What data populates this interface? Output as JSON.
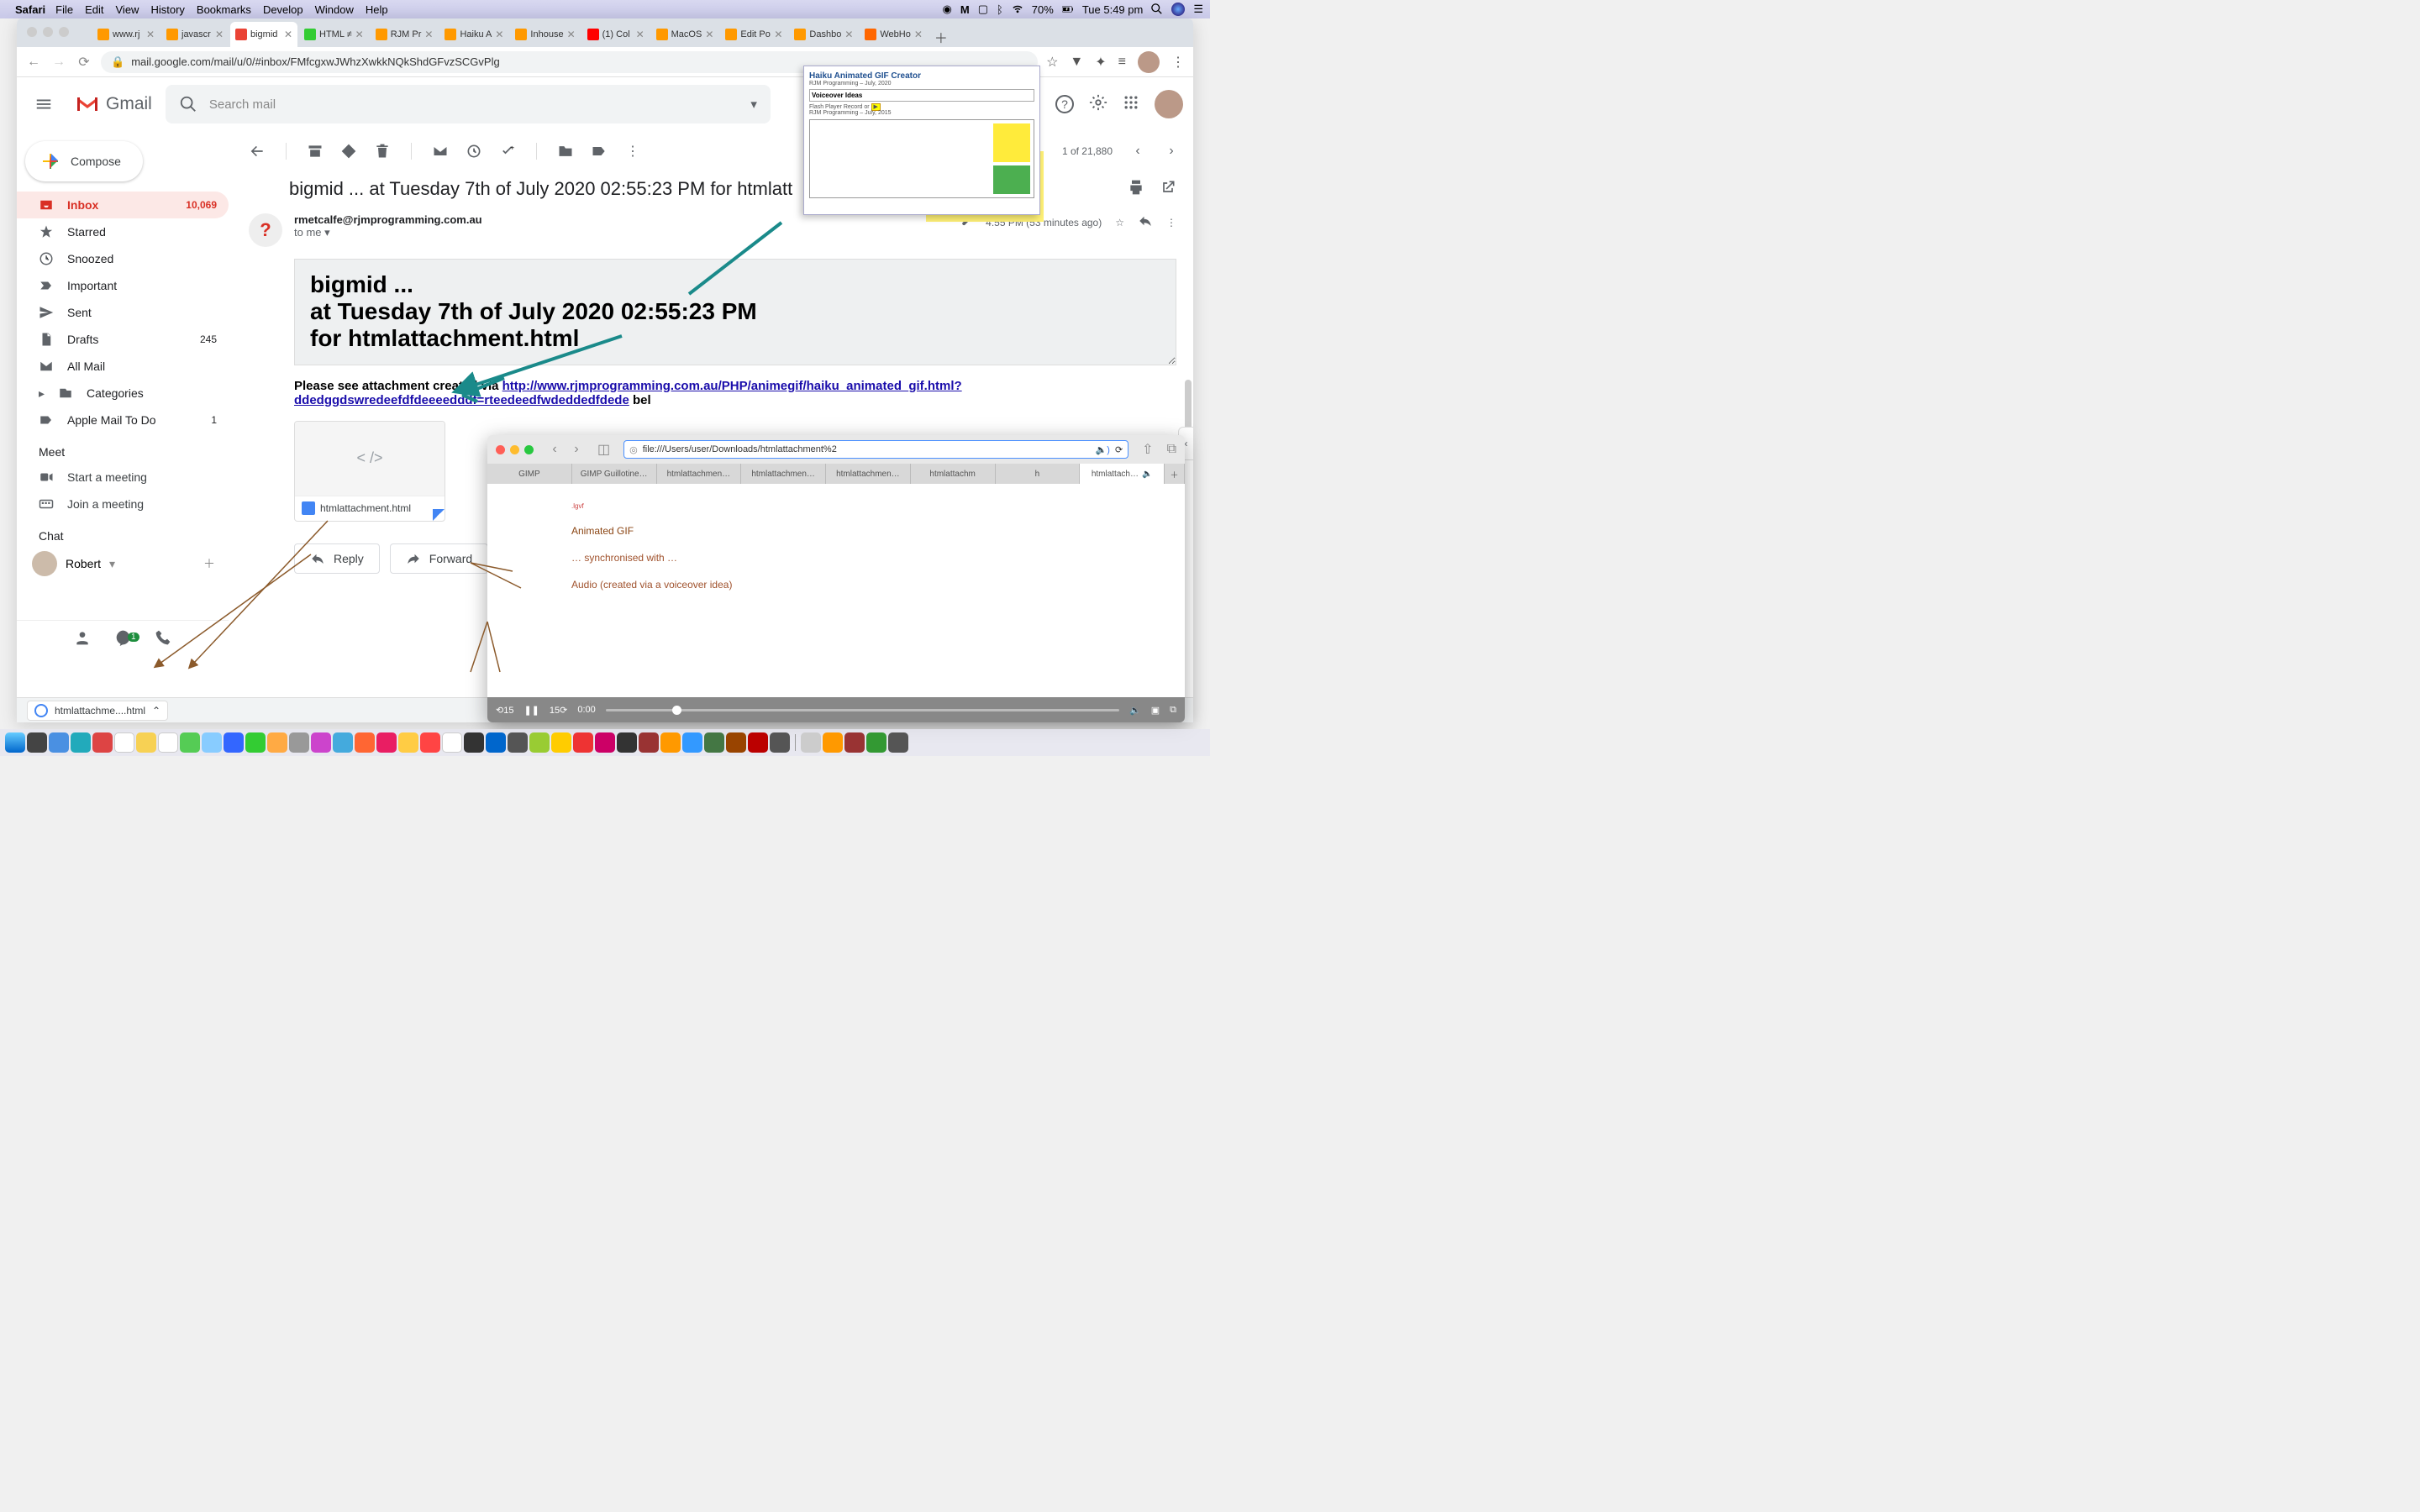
{
  "menubar": {
    "app": "Safari",
    "items": [
      "File",
      "Edit",
      "View",
      "History",
      "Bookmarks",
      "Develop",
      "Window",
      "Help"
    ],
    "battery_pct": "70%",
    "clock": "Tue 5:49 pm"
  },
  "tabs": [
    {
      "label": "www.rj"
    },
    {
      "label": "javascr"
    },
    {
      "label": "bigmid",
      "active": true
    },
    {
      "label": "HTML ≠"
    },
    {
      "label": "RJM Pr"
    },
    {
      "label": "Haiku A"
    },
    {
      "label": "Inhouse"
    },
    {
      "label": "(1) Col"
    },
    {
      "label": "MacOS"
    },
    {
      "label": "Edit Po"
    },
    {
      "label": "Dashbo"
    },
    {
      "label": "WebHo"
    }
  ],
  "omnibox": {
    "url": "mail.google.com/mail/u/0/#inbox/FMfcgxwJWhzXwkkNQkShdGFvzSCGvPlg"
  },
  "gmail": {
    "brand": "Gmail",
    "search_placeholder": "Search mail",
    "compose": "Compose",
    "sidebar": [
      {
        "label": "Inbox",
        "count": "10,069",
        "active": true,
        "icon": "inbox"
      },
      {
        "label": "Starred",
        "icon": "star"
      },
      {
        "label": "Snoozed",
        "icon": "clock"
      },
      {
        "label": "Important",
        "icon": "important"
      },
      {
        "label": "Sent",
        "icon": "send"
      },
      {
        "label": "Drafts",
        "count": "245",
        "icon": "file"
      },
      {
        "label": "All Mail",
        "icon": "mail"
      },
      {
        "label": "Categories",
        "icon": "tag",
        "expandable": true
      },
      {
        "label": "Apple Mail To Do",
        "count": "1",
        "icon": "tag"
      }
    ],
    "meet_header": "Meet",
    "meet": [
      {
        "label": "Start a meeting",
        "icon": "video"
      },
      {
        "label": "Join a meeting",
        "icon": "keyboard"
      }
    ],
    "chat_header": "Chat",
    "chat_user": "Robert",
    "page_counter": "1 of 21,880"
  },
  "email": {
    "subject": "bigmid ... at Tuesday 7th of July 2020 02:55:23 PM for htmlatt",
    "from": "rmetcalfe@rjmprogramming.com.au",
    "to": "to me",
    "time": "4:55 PM (53 minutes ago)",
    "body_lines": [
      "bigmid ...",
      "  at Tuesday 7th of July 2020 02:55:23 PM",
      "  for htmlattachment.html"
    ],
    "see_text": "Please see attachment created via ",
    "link": "http://www.rjmprogramming.com.au/PHP/animegif/haiku_animated_gif.html?ddedggdswredeefdfdeeeedddf=rteedeedfwdeddedfdede",
    "below": " bel",
    "reply": "Reply",
    "forward": "Forward",
    "attachment": "htmlattachment.html"
  },
  "download_chip": "htmlattachme....html",
  "safari2": {
    "url": "file:///Users/user/Downloads/htmlattachment%2",
    "tabs": [
      "GIMP",
      "GIMP Guillotine…",
      "htmlattachmen…",
      "htmlattachmen…",
      "htmlattachmen…",
      "htmlattachm",
      "h",
      "htmlattach…"
    ],
    "lines": [
      "Animated GIF",
      "… synchronised with …",
      "Audio (created via a voiceover idea)"
    ],
    "tiny": ".lgvf",
    "time": "0:00"
  },
  "preview": {
    "title": "Haiku Animated GIF Creator",
    "sub1": "RJM Programming – July, 2020",
    "box": "Voiceover Ideas",
    "sub2": "Flash Player Record or",
    "sub3": "RJM Programming – July, 2015"
  }
}
